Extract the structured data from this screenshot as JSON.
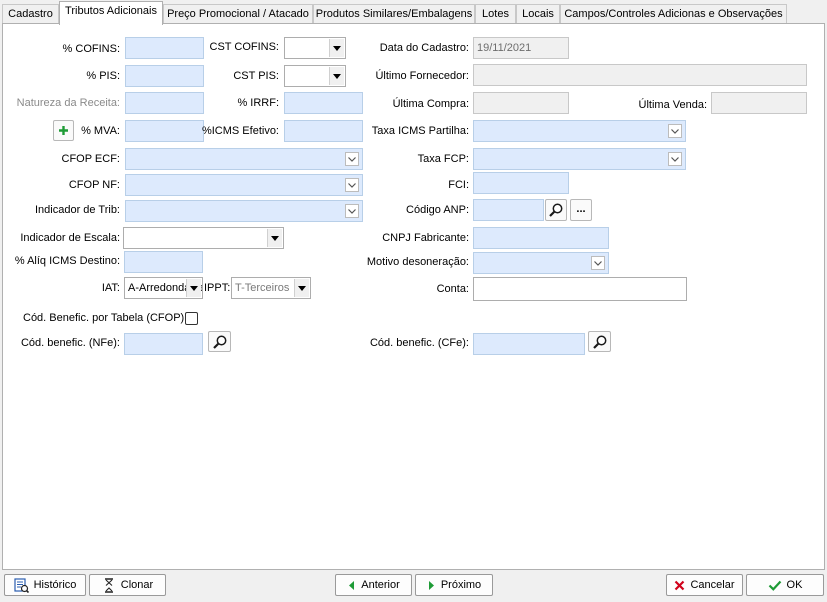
{
  "tabs": [
    {
      "label": "Cadastro"
    },
    {
      "label": "Tributos Adicionais"
    },
    {
      "label": "Preço Promocional / Atacado"
    },
    {
      "label": "Produtos Similares/Embalagens"
    },
    {
      "label": "Lotes"
    },
    {
      "label": "Locais"
    },
    {
      "label": "Campos/Controles Adicionas e Observações"
    }
  ],
  "form": {
    "cofins_label": "% COFINS:",
    "cst_cofins_label": "CST COFINS:",
    "data_cadastro_label": "Data do Cadastro:",
    "data_cadastro_value": "19/11/2021",
    "pis_label": "% PIS:",
    "cst_pis_label": "CST PIS:",
    "ultimo_fornecedor_label": "Último Fornecedor:",
    "natureza_receita_label": "Natureza da Receita:",
    "irrf_label": "% IRRF:",
    "ultima_compra_label": "Última Compra:",
    "ultima_venda_label": "Última Venda:",
    "mva_label": "% MVA:",
    "icms_efetivo_label": "%ICMS Efetivo:",
    "taxa_icms_partilha_label": "Taxa ICMS Partilha:",
    "cfop_ecf_label": "CFOP ECF:",
    "taxa_fcp_label": "Taxa FCP:",
    "cfop_nf_label": "CFOP NF:",
    "fci_label": "FCI:",
    "indicador_trib_label": "Indicador de Trib:",
    "codigo_anp_label": "Código ANP:",
    "indicador_escala_label": "Indicador de Escala:",
    "cnpj_fabricante_label": "CNPJ Fabricante:",
    "aliq_icms_destino_label": "% Alíq ICMS Destino:",
    "motivo_desoneracao_label": "Motivo desoneração:",
    "iat_label": "IAT:",
    "iat_value": "A-Arredondamento",
    "ippt_label": "IPPT:",
    "ippt_value": "T-Terceiros",
    "conta_label": "Conta:",
    "cod_benefic_tabela_label": "Cód. Benefic. por Tabela (CFOP)",
    "cod_benefic_nfe_label": "Cód. benefic. (NFe):",
    "cod_benefic_cfe_label": "Cód. benefic. (CFe):",
    "ellipsis_label": "..."
  },
  "buttons": {
    "historico": "Histórico",
    "clonar": "Clonar",
    "anterior": "Anterior",
    "proximo": "Próximo",
    "cancelar": "Cancelar",
    "ok": "OK"
  },
  "icons": {
    "plus": "plus-icon",
    "search": "magnifier-icon",
    "historico": "history-icon",
    "clonar": "clone-icon",
    "anterior": "arrow-left-icon",
    "proximo": "arrow-right-icon",
    "cancelar": "x-icon",
    "ok": "check-icon"
  },
  "colors": {
    "input_blue": "#ddeafd",
    "accent_green": "#1e9b36",
    "cancel_red": "#d0021b"
  }
}
